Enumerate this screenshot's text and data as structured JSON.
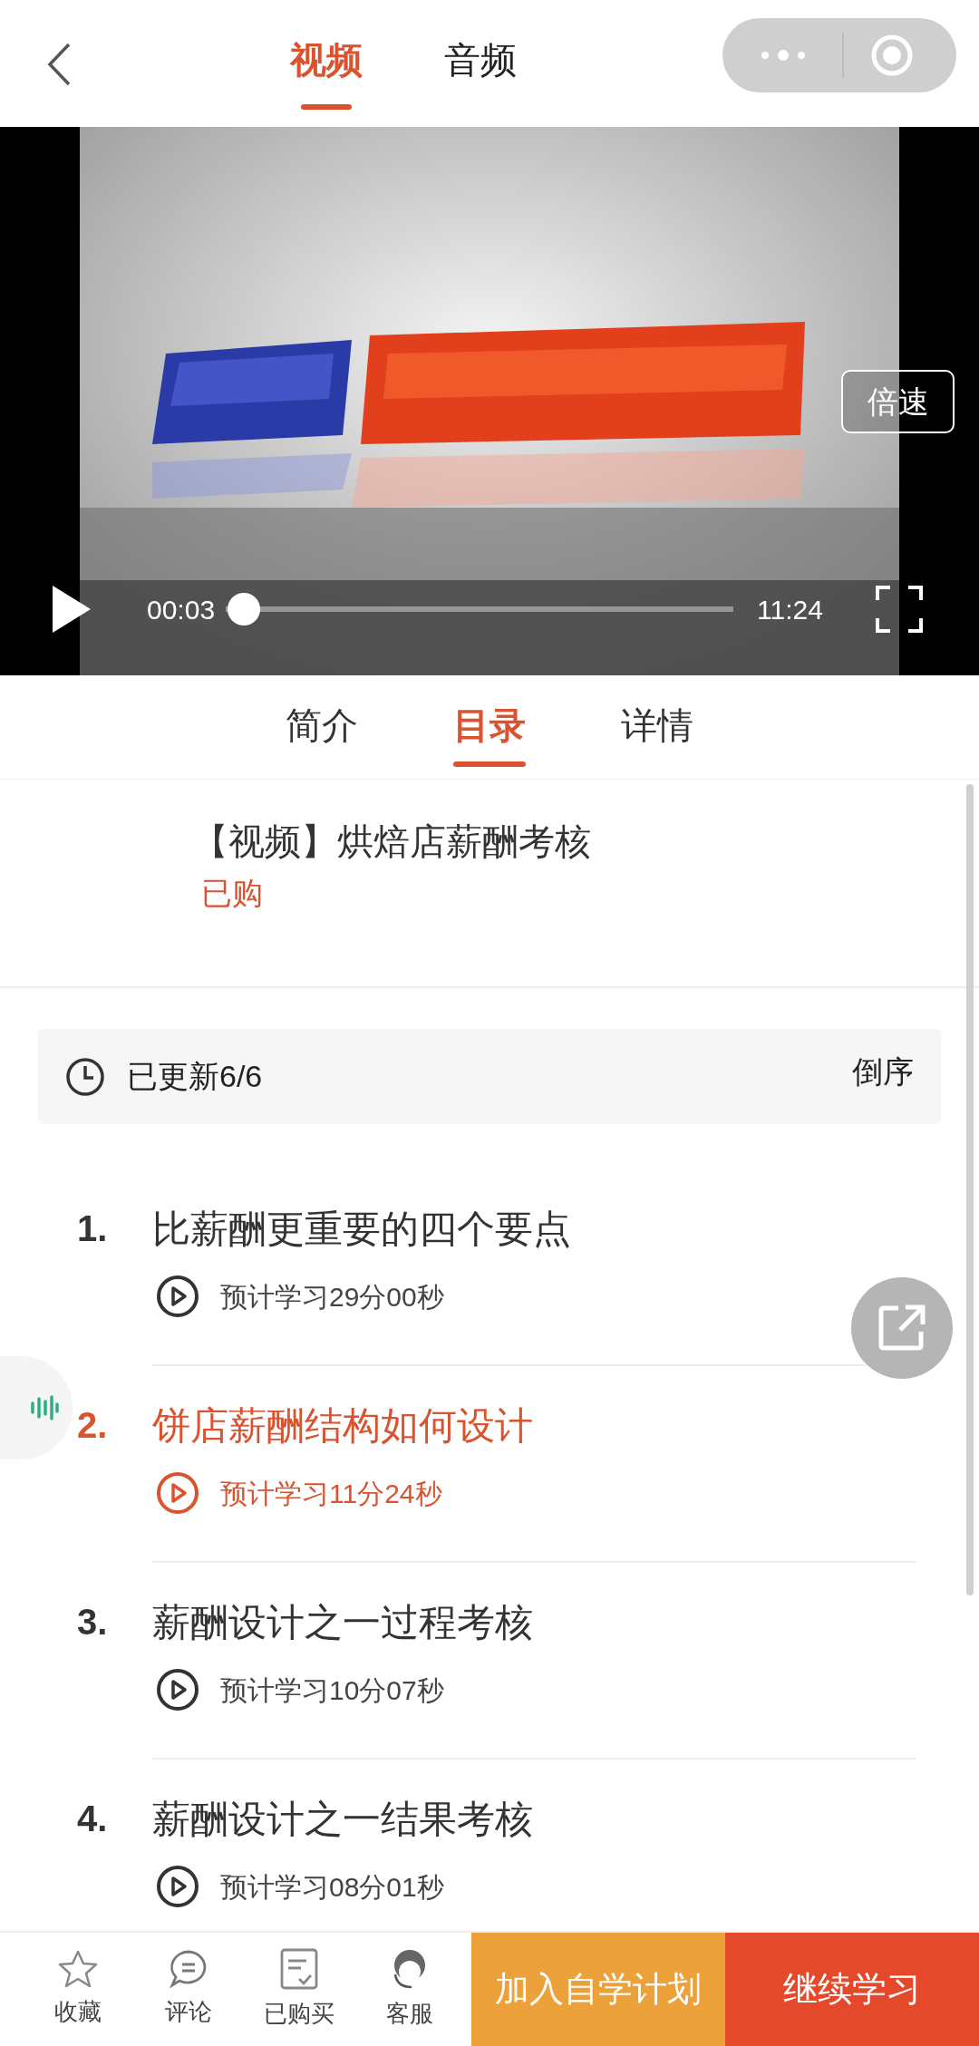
{
  "header": {
    "tabs": [
      {
        "label": "视频",
        "selected": true
      },
      {
        "label": "音频",
        "selected": false
      }
    ]
  },
  "player": {
    "speed_button": "倍速",
    "current_time": "00:03",
    "duration": "11:24",
    "level": 0.004
  },
  "content_tabs": [
    {
      "label": "简介",
      "selected": false
    },
    {
      "label": "目录",
      "selected": true
    },
    {
      "label": "详情",
      "selected": false
    }
  ],
  "course": {
    "title": "【视频】烘焙店薪酬考核",
    "badge": "已购"
  },
  "updates": {
    "status": "已更新6/6",
    "sort": "倒序"
  },
  "lessons": [
    {
      "number": "1.",
      "title": "比薪酬更重要的四个要点",
      "duration": "预计学习29分00秒",
      "selected": false
    },
    {
      "number": "2.",
      "title": "饼店薪酬结构如何设计",
      "duration": "预计学习11分24秒",
      "selected": true
    },
    {
      "number": "3.",
      "title": "薪酬设计之一过程考核",
      "duration": "预计学习10分07秒",
      "selected": false
    },
    {
      "number": "4.",
      "title": "薪酬设计之一结果考核",
      "duration": "预计学习08分01秒",
      "selected": false
    }
  ],
  "bottom_bar": {
    "actions": [
      {
        "label": "收藏",
        "kind": "star"
      },
      {
        "label": "评论",
        "kind": "comment"
      },
      {
        "label": "已购买",
        "kind": "orders"
      },
      {
        "label": "客服",
        "kind": "support"
      }
    ],
    "buttons": [
      {
        "label": "加入自学计划",
        "kind": "secondary"
      },
      {
        "label": "继续学习",
        "kind": "primary"
      }
    ]
  }
}
